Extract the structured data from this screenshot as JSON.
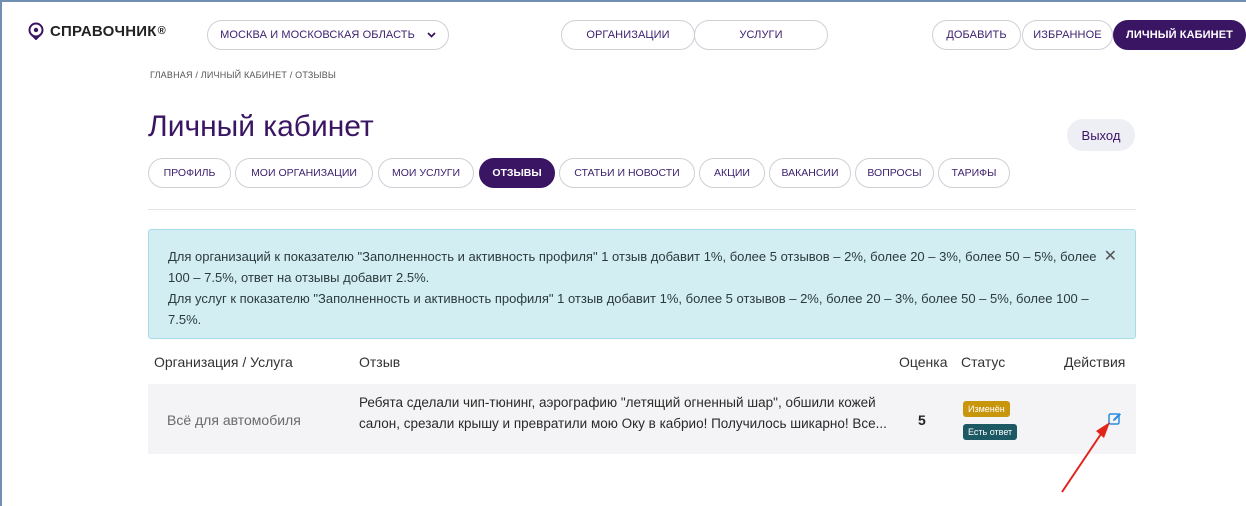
{
  "header": {
    "logo": "СПРАВОЧНИК",
    "logo_mark": "®",
    "region": "МОСКВА И МОСКОВСКАЯ ОБЛАСТЬ",
    "nav": {
      "organizations": "ОРГАНИЗАЦИИ",
      "services": "УСЛУГИ"
    },
    "add": "ДОБАВИТЬ",
    "favorites": "ИЗБРАННОЕ",
    "cabinet": "ЛИЧНЫЙ КАБИНЕТ"
  },
  "breadcrumb": "ГЛАВНАЯ / ЛИЧНЫЙ КАБИНЕТ / ОТЗЫВЫ",
  "page_title": "Личный кабинет",
  "logout": "Выход",
  "tabs": [
    "ПРОФИЛЬ",
    "МОИ ОРГАНИЗАЦИИ",
    "МОИ УСЛУГИ",
    "ОТЗЫВЫ",
    "СТАТЬИ И НОВОСТИ",
    "АКЦИИ",
    "ВАКАНСИИ",
    "ВОПРОСЫ",
    "ТАРИФЫ"
  ],
  "active_tab": "ОТЗЫВЫ",
  "alert": {
    "line1": "Для организаций к показателю \"Заполненность и активность профиля\" 1 отзыв добавит 1%, более 5 отзывов – 2%, более 20 – 3%, более 50 – 5%, более 100 – 7.5%, ответ на отзывы добавит 2.5%.",
    "line2": "Для услуг к показателю \"Заполненность и активность профиля\" 1 отзыв добавит 1%, более 5 отзывов – 2%, более 20 – 3%, более 50 – 5%, более 100 – 7.5%.",
    "close": "✕"
  },
  "table": {
    "headers": {
      "org": "Организация / Услуга",
      "review": "Отзыв",
      "score": "Оценка",
      "status": "Статус",
      "actions": "Действия"
    },
    "rows": [
      {
        "org": "Всё для автомобиля",
        "review": "Ребята сделали чип-тюнинг, аэрографию \"летящий огненный шар\", обшили кожей салон, срезали крышу и превратили мою Оку в кабрио! Получилось шикарно! Все...",
        "score": "5",
        "status_changed": "Изменён",
        "status_answered": "Есть ответ"
      }
    ]
  },
  "colors": {
    "brand": "#3a1563",
    "alert_bg": "#d3eef2",
    "badge_changed": "#c7960b",
    "badge_answered": "#1d5964",
    "edit_icon": "#2a8be0",
    "annotation_arrow": "#e0241b"
  },
  "icons": [
    "location-pin-icon",
    "chevron-down-icon",
    "close-icon",
    "edit-icon"
  ]
}
